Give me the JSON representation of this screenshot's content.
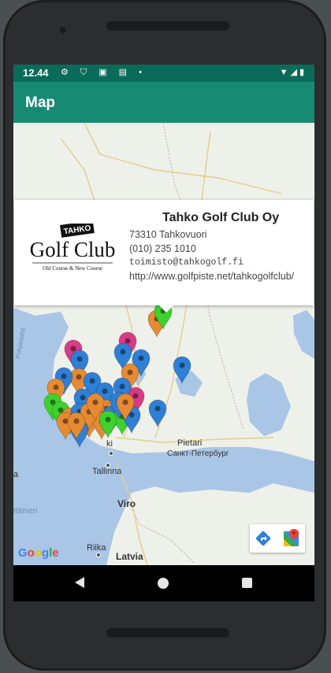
{
  "status": {
    "time": "12.44",
    "left_icons": "⚙ ⛉ ▣ ▤ •",
    "right_icons": "▼◢▮"
  },
  "appbar": {
    "title": "Map"
  },
  "info": {
    "name": "Tahko Golf Club Oy",
    "address": "73310 Tahkovuori",
    "phone": "(010) 235 1010",
    "email": "toimisto@tahkogolf.fi",
    "url": "http://www.golfpiste.net/tahkogolfclub/",
    "logo_badge": "TAHKO",
    "logo_main": "Golf Club",
    "logo_sub": "Old Course & New Course"
  },
  "map": {
    "labels": {
      "pietari": "Pietari",
      "spb": "Санкт-Петербург",
      "tallinna": "Tallinna",
      "viro": "Viro",
      "riika": "Riika",
      "latvia": "Latvia",
      "itameri": "Itämeri",
      "pohjanlahti": "Pohjanlahti",
      "ki": "ki",
      "a": "a"
    },
    "google": "Google",
    "colors": {
      "water": "#a9c6e6",
      "land": "#eef0ea",
      "pin_blue": "#2f7fd6",
      "pin_orange": "#e68a33",
      "pin_green": "#3fd12e",
      "pin_pink": "#d93a86"
    }
  }
}
